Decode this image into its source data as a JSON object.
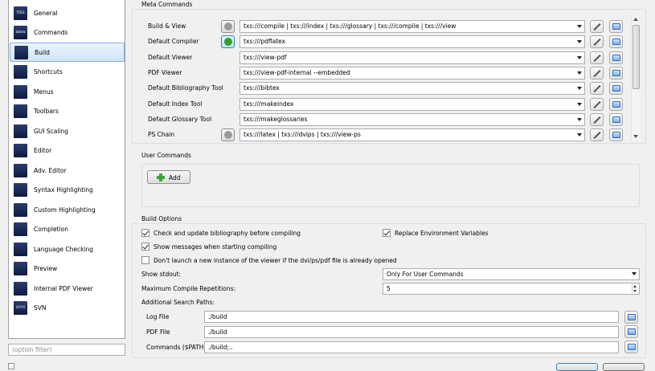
{
  "sidebar": {
    "items": [
      {
        "label": "General",
        "icon": "txs-logo-icon",
        "glyph": "TXS"
      },
      {
        "label": "Commands",
        "icon": "latex-icon",
        "glyph": "latex"
      },
      {
        "label": "Build",
        "icon": "build-icon",
        "glyph": ""
      },
      {
        "label": "Shortcuts",
        "icon": "shortcuts-icon",
        "glyph": ""
      },
      {
        "label": "Menus",
        "icon": "menus-icon",
        "glyph": ""
      },
      {
        "label": "Toolbars",
        "icon": "toolbars-icon",
        "glyph": ""
      },
      {
        "label": "GUI Scaling",
        "icon": "gui-scaling-icon",
        "glyph": ""
      },
      {
        "label": "Editor",
        "icon": "editor-icon",
        "glyph": ""
      },
      {
        "label": "Adv. Editor",
        "icon": "adv-editor-icon",
        "glyph": ""
      },
      {
        "label": "Syntax Highlighting",
        "icon": "syntax-highlighting-icon",
        "glyph": ""
      },
      {
        "label": "Custom Highlighting",
        "icon": "custom-highlighting-icon",
        "glyph": ""
      },
      {
        "label": "Completion",
        "icon": "completion-icon",
        "glyph": ""
      },
      {
        "label": "Language Checking",
        "icon": "language-checking-icon",
        "glyph": ""
      },
      {
        "label": "Preview",
        "icon": "preview-icon",
        "glyph": ""
      },
      {
        "label": "Internal PDF Viewer",
        "icon": "pdf-viewer-icon",
        "glyph": ""
      },
      {
        "label": "SVN",
        "icon": "svn-icon",
        "glyph": "SVN"
      }
    ],
    "selected": "Build",
    "filter_placeholder": "(option filter)"
  },
  "meta_commands": {
    "title": "Meta Commands",
    "rows": [
      {
        "label": "Build & View",
        "value": "txs:///compile | txs:///index | txs:///glossary | txs:///compile | txs:///view",
        "has_run": true
      },
      {
        "label": "Default Compiler",
        "value": "txs:///pdflatex",
        "has_run": true
      },
      {
        "label": "Default Viewer",
        "value": "txs:///view-pdf",
        "has_run": false
      },
      {
        "label": "PDF Viewer",
        "value": "txs:///view-pdf-internal --embedded",
        "has_run": false
      },
      {
        "label": "Default Bibliography Tool",
        "value": "txs:///bibtex",
        "has_run": false
      },
      {
        "label": "Default Index Tool",
        "value": "txs:///makeindex",
        "has_run": false
      },
      {
        "label": "Default Glossary Tool",
        "value": "txs:///makeglossaries",
        "has_run": false
      },
      {
        "label": "PS Chain",
        "value": "txs:///latex | txs:///dvips | txs:///view-ps",
        "has_run": true
      }
    ]
  },
  "user_commands": {
    "title": "User Commands",
    "add_label": "Add"
  },
  "build_options": {
    "title": "Build Options",
    "check_bibliography": {
      "label": "Check and update bibliography before compiling",
      "checked": true
    },
    "replace_env": {
      "label": "Replace Environment Variables",
      "checked": true
    },
    "show_messages": {
      "label": "Show messages when starting compiling",
      "checked": true
    },
    "dont_launch": {
      "label": "Don't launch a new instance of the viewer if the dvi/ps/pdf file is already opened",
      "checked": false
    },
    "show_stdout_label": "Show stdout:",
    "show_stdout_value": "Only For User Commands",
    "max_repetitions_label": "Maximum Compile Repetitions:",
    "max_repetitions_value": "5",
    "search_paths_label": "Additional Search Paths:",
    "log_file_label": "Log File",
    "log_file_value": "./build",
    "pdf_file_label": "PDF File",
    "pdf_file_value": "./build",
    "commands_label": "Commands ($PATH)",
    "commands_value": "./build;.."
  },
  "colors": {
    "selection_bg": "#cfe6fb",
    "selection_border": "#84acdd",
    "run_green": "#2aa52a"
  }
}
